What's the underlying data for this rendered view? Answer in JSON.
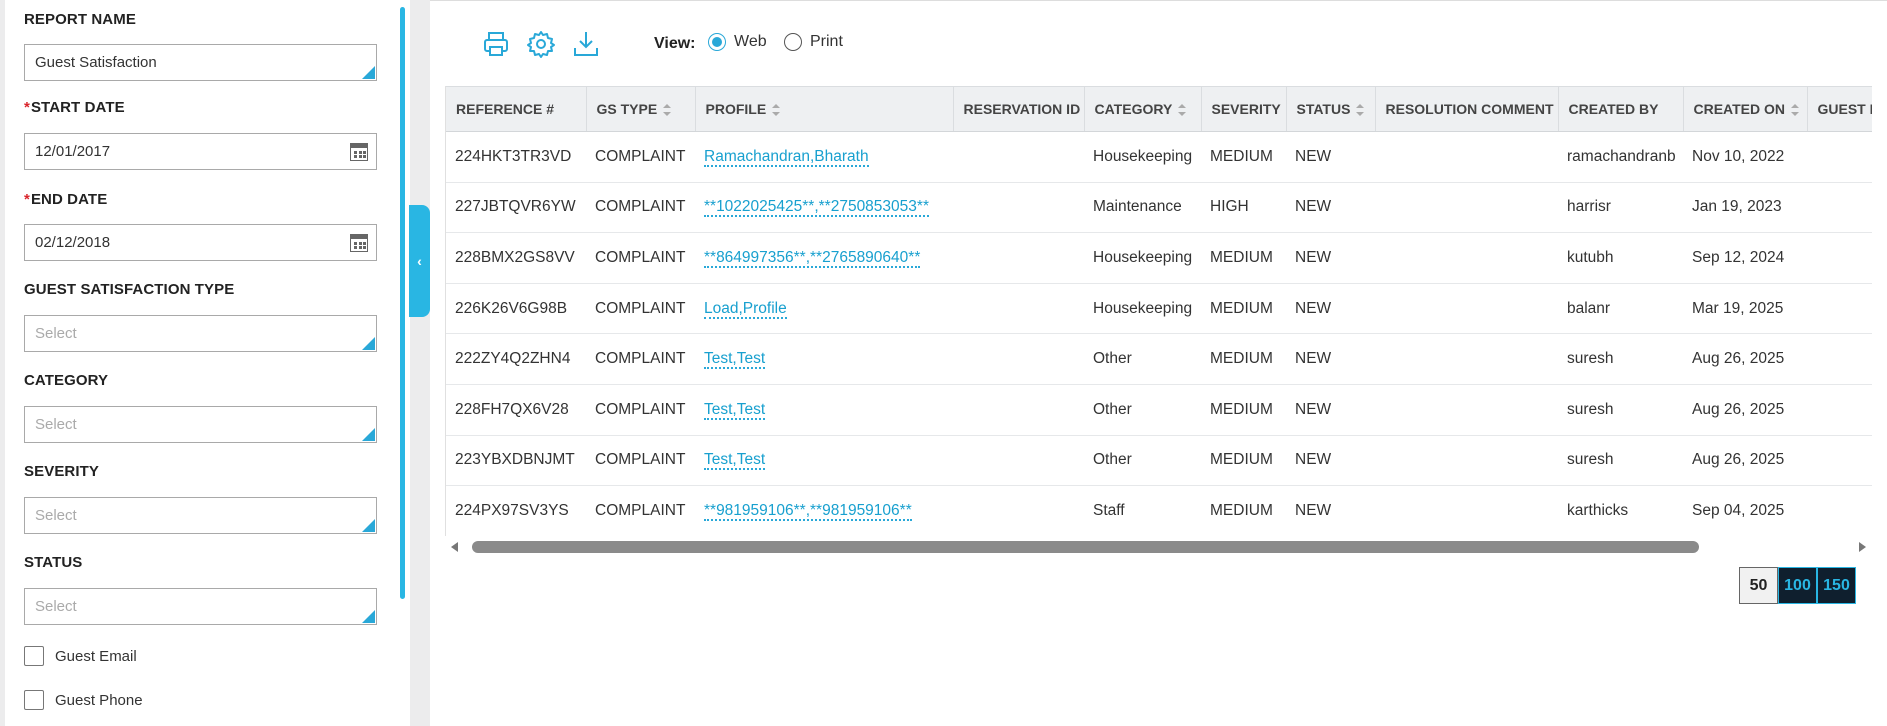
{
  "filters": {
    "report_name_label": "REPORT NAME",
    "report_name_value": "Guest Satisfaction",
    "start_date_label": "START DATE",
    "start_date_value": "12/01/2017",
    "end_date_label": "END DATE",
    "end_date_value": "02/12/2018",
    "required_mark": "*",
    "gs_type_label": "GUEST SATISFACTION TYPE",
    "category_label": "CATEGORY",
    "severity_label": "SEVERITY",
    "status_label": "STATUS",
    "select_placeholder": "Select",
    "guest_email_label": "Guest Email",
    "guest_phone_label": "Guest Phone"
  },
  "collapse_glyph": "‹",
  "toolbar": {
    "icons": [
      "print-icon",
      "settings-gear-icon",
      "download-icon"
    ],
    "view_label": "View:",
    "view_options": [
      "Web",
      "Print"
    ],
    "view_selected": "Web"
  },
  "table": {
    "columns": [
      "REFERENCE #",
      "GS TYPE",
      "PROFILE",
      "RESERVATION ID",
      "CATEGORY",
      "SEVERITY",
      "STATUS",
      "RESOLUTION COMMENT",
      "CREATED BY",
      "CREATED ON",
      "GUEST E"
    ],
    "rows": [
      [
        "224HKT3TR3VD",
        "COMPLAINT",
        "Ramachandran,Bharath",
        "",
        "Housekeeping",
        "MEDIUM",
        "NEW",
        "",
        "ramachandranb",
        "Nov 10, 2022",
        ""
      ],
      [
        "227JBTQVR6YW",
        "COMPLAINT",
        "**1022025425**,**2750853053**",
        "",
        "Maintenance",
        "HIGH",
        "NEW",
        "",
        "harrisr",
        "Jan 19, 2023",
        ""
      ],
      [
        "228BMX2GS8VV",
        "COMPLAINT",
        "**864997356**,**2765890640**",
        "",
        "Housekeeping",
        "MEDIUM",
        "NEW",
        "",
        "kutubh",
        "Sep 12, 2024",
        ""
      ],
      [
        "226K26V6G98B",
        "COMPLAINT",
        "Load,Profile",
        "",
        "Housekeeping",
        "MEDIUM",
        "NEW",
        "",
        "balanr",
        "Mar 19, 2025",
        ""
      ],
      [
        "222ZY4Q2ZHN4",
        "COMPLAINT",
        "Test,Test",
        "",
        "Other",
        "MEDIUM",
        "NEW",
        "",
        "suresh",
        "Aug 26, 2025",
        ""
      ],
      [
        "228FH7QX6V28",
        "COMPLAINT",
        "Test,Test",
        "",
        "Other",
        "MEDIUM",
        "NEW",
        "",
        "suresh",
        "Aug 26, 2025",
        ""
      ],
      [
        "223YBXDBNJMT",
        "COMPLAINT",
        "Test,Test",
        "",
        "Other",
        "MEDIUM",
        "NEW",
        "",
        "suresh",
        "Aug 26, 2025",
        ""
      ],
      [
        "224PX97SV3YS",
        "COMPLAINT",
        "**981959106**,**981959106**",
        "",
        "Staff",
        "MEDIUM",
        "NEW",
        "",
        "karthicks",
        "Sep 04, 2025",
        ""
      ]
    ]
  },
  "pager": {
    "sizes": [
      "50",
      "100",
      "150"
    ],
    "active": "50"
  },
  "colors": {
    "accent": "#29b6e3",
    "link": "#18a0cf"
  }
}
